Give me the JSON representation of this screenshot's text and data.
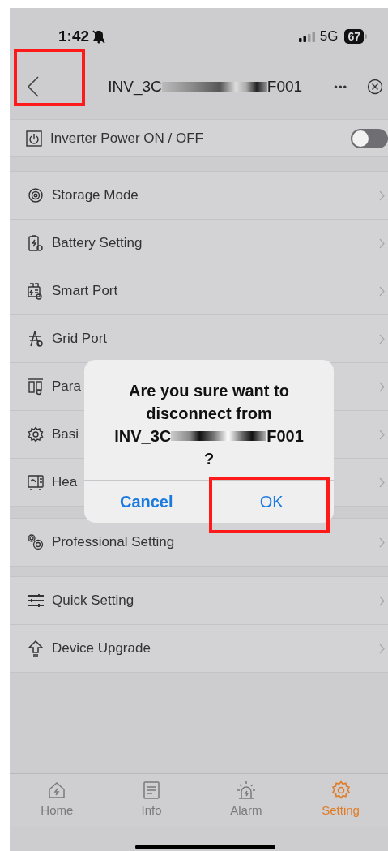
{
  "status_bar": {
    "time": "1:42",
    "network": "5G",
    "battery": "67"
  },
  "nav": {
    "title_prefix": "INV_3C",
    "title_suffix": "F001",
    "more": "•••"
  },
  "power_row": {
    "label": "Inverter Power ON / OFF",
    "on": false
  },
  "menu_groups": [
    [
      {
        "label": "Storage Mode"
      },
      {
        "label": "Battery Setting"
      },
      {
        "label": "Smart Port"
      },
      {
        "label": "Grid Port"
      },
      {
        "label": "Para"
      },
      {
        "label": "Basi"
      },
      {
        "label": "Hea"
      }
    ],
    [
      {
        "label": "Professional Setting"
      }
    ],
    [
      {
        "label": "Quick Setting"
      },
      {
        "label": "Device Upgrade"
      }
    ]
  ],
  "dialog": {
    "message": "Are you sure want to disconnect from",
    "device_prefix": "INV_3C",
    "device_suffix": "F001",
    "question_mark": "?",
    "buttons": [
      "Cancel",
      "OK"
    ]
  },
  "tabs": [
    {
      "label": "Home",
      "selected": false
    },
    {
      "label": "Info",
      "selected": false
    },
    {
      "label": "Alarm",
      "selected": false
    },
    {
      "label": "Setting",
      "selected": true
    }
  ]
}
